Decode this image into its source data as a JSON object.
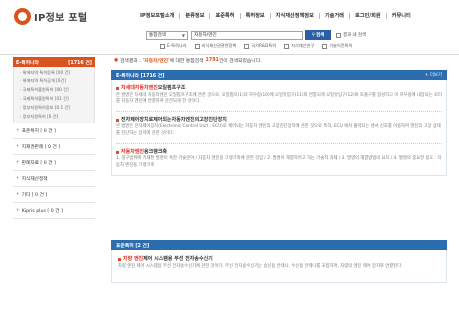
{
  "logo": {
    "text": "IP정보 포털"
  },
  "topnav": {
    "items": [
      "IP정보포털소개",
      "분류정보",
      "표준특허",
      "특허정보",
      "지식재산정책정보",
      "기술거래",
      "로그인/회원",
      "커뮤니티"
    ]
  },
  "search": {
    "scope": "통합검색",
    "query": "자동차/엔진",
    "button": "검색",
    "recheck": "결과 내 검색"
  },
  "filters": [
    "E-특허나라",
    "지식재산권관련정책",
    "국가R&D특허",
    "지식재산연구",
    "기술이전특허"
  ],
  "summary": {
    "prefix": "검색결과 :",
    "query": "'자동차/엔진'",
    "middle": "에 대한 통합검색",
    "count": "1791",
    "suffix": "건이 검색되었습니다."
  },
  "sidebar": {
    "active": {
      "label": "E-특허나라",
      "count": "[1716 건]"
    },
    "sub_items": [
      "· 위에지역 특허등록 [00 건]",
      "· 위에지역 특허공개 [0건]",
      "· 국제특허출원특허 [00 건]",
      "· 국제특허출원특허 [01 건]",
      "· 정부지원특허정보 [0 1 건]",
      "· 정부지원특허 [0 건]"
    ],
    "categories": [
      "표준특허 [ 0 건 ]",
      "지재권판례 [ 0 건 ]",
      "판례자료 [ 0 건 ]",
      "지식재산정책",
      "기타 [ 0 건 ]",
      "Kipris plus [ 0 건 ]"
    ]
  },
  "section1": {
    "title": "E-특허나라",
    "count": "[1716 건]",
    "more": "+ 더보기",
    "results": [
      {
        "hl": "차세대자동차엔진",
        "rest": "오일펌프구조",
        "text": "본 발명은 차세대 자동차엔진 오일펌프구조에 관한 것으로, 오일펌프(1)의 하우징(10)에 오일유입구(11)와 연통되게 오일유입구(12)와 토출구를 형성하고 이 하우징에 내장되는 로터를 자동차 엔진에 연결하여 운전되게 한 것이다."
      },
      {
        "hl": "",
        "rest": "전자제어장치로제어되는자동차엔진의고장진단장치",
        "text": "본 발명은 전자제어장치(Electronic Control Unit : ECU)로 제어되는 자동차 엔진의 고장진단장치에 관한 것으로 특히, ECU 에서 출력되는 센서 신호를 이용하여 엔진의 고장 상태를 진단하는 장치에 관한 것이다."
      },
      {
        "hl": "자동차엔진",
        "rest": "용크랭크축",
        "text": "1. 청구범위에 기재된 발명이 속한 기술분야 / 자동차 엔진용 크랭크축에 관한 것임 / 2. 발명이 해결하려고 하는 기술적 과제 / 3. 발명의 해결방법의 요지 / 4. 발명의 중요한 용도 : 자동차 엔진용 크랭크축"
      }
    ]
  },
  "section2": {
    "title": "표준특허",
    "count": "[2 건]",
    "results": [
      {
        "hl": "차량 엔진",
        "rest": "제어 시스템용 무선 전자송수신기",
        "text": "차량 엔진 제어 시스템용 무선 전자송수신기에 관한 것이다. 무선 전자송수신기는 송신용 안테나, 수신용 안테나를 포함하며, 차량의 엔진 제어 장치와 연결된다."
      }
    ]
  }
}
